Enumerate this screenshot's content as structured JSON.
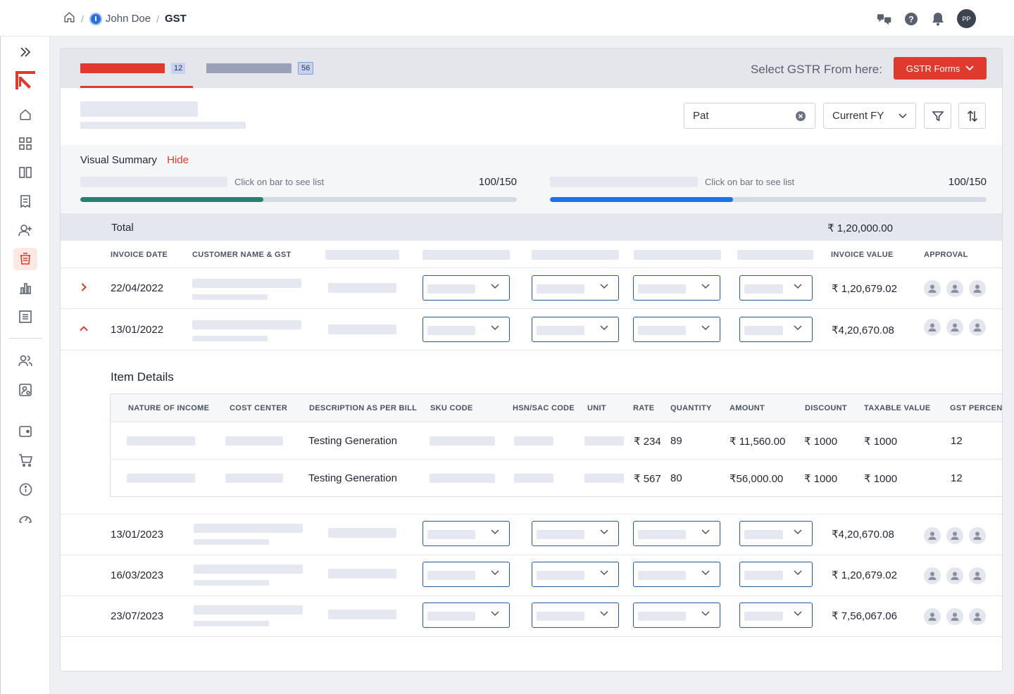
{
  "breadcrumb": {
    "user": "John Doe",
    "current": "GST"
  },
  "header": {
    "avatar_initials": "PP"
  },
  "tabs": [
    {
      "badge": "12"
    },
    {
      "badge": "56"
    }
  ],
  "gstr": {
    "label": "Select GSTR From here:",
    "button": "GSTR Forms"
  },
  "filters": {
    "search_value": "Pat",
    "fy_value": "Current FY"
  },
  "summary": {
    "title": "Visual Summary",
    "hide_label": "Hide",
    "cards": [
      {
        "hint": "Click on bar to see list",
        "count": "100/150",
        "progress": 0.42,
        "color": "#2a8073"
      },
      {
        "hint": "Click on bar to see list",
        "count": "100/150",
        "progress": 0.42,
        "color": "#1a73e8"
      }
    ]
  },
  "total": {
    "label": "Total",
    "value": "₹ 1,20,000.00"
  },
  "table": {
    "headers": {
      "invoice_date": "INVOICE DATE",
      "customer": "CUSTOMER NAME & GST",
      "invoice_value": "INVOICE VALUE",
      "approval": "APPROVAL"
    },
    "rows": [
      {
        "date": "22/04/2022",
        "amount": "₹ 1,20,679.02"
      },
      {
        "date": "13/01/2022",
        "amount": "₹4,20,670.08"
      },
      {
        "date": "13/01/2023",
        "amount": "₹4,20,670.08"
      },
      {
        "date": "16/03/2023",
        "amount": "₹ 1,20,679.02"
      },
      {
        "date": "23/07/2023",
        "amount": "₹ 7,56,067.06"
      }
    ]
  },
  "item_details": {
    "title": "Item Details",
    "headers": [
      "NATURE OF INCOME",
      "COST CENTER",
      "DESCRIPTION AS PER BILL",
      "SKU CODE",
      "HSN/SAC CODE",
      "UNIT",
      "RATE",
      "QUANTITY",
      "AMOUNT",
      "DISCOUNT",
      "TAXABLE VALUE",
      "GST PERCENT"
    ],
    "rows": [
      {
        "description": "Testing Generation",
        "rate": "₹ 234",
        "quantity": "89",
        "amount": "₹ 11,560.00",
        "discount": "₹ 1000",
        "taxable": "₹ 1000",
        "gst": "12"
      },
      {
        "description": "Testing Generation",
        "rate": "₹ 567",
        "quantity": "80",
        "amount": "₹56,000.00",
        "discount": "₹ 1000",
        "taxable": "₹ 1000",
        "gst": "12"
      }
    ]
  },
  "colors": {
    "accent": "#e03a2f",
    "dropdown_border": "#1e5aa8"
  }
}
